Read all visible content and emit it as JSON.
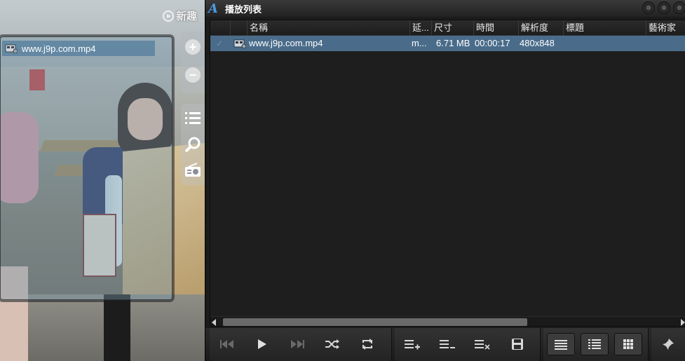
{
  "video": {
    "watermark": "新趣"
  },
  "mini_playlist": {
    "items": [
      {
        "name": "www.j9p.com.mp4"
      }
    ]
  },
  "video_controls": [
    {
      "icon": "zoom-in-icon"
    },
    {
      "icon": "zoom-out-icon"
    },
    {
      "icon": "playlist-icon"
    },
    {
      "icon": "search-icon"
    },
    {
      "icon": "radio-icon"
    }
  ],
  "window": {
    "title": "播放列表",
    "logo": "A"
  },
  "playlist": {
    "columns": [
      "名稱",
      "延...",
      "尺寸",
      "時間",
      "解析度",
      "標題",
      "藝術家"
    ],
    "rows": [
      {
        "name": "www.j9p.com.mp4",
        "ext": "m...",
        "size": "6.71 MB",
        "duration": "00:00:17",
        "resolution": "480x848",
        "title": "",
        "artist": ""
      }
    ]
  },
  "toolbar": {
    "buttons": [
      {
        "icon": "previous-icon",
        "enabled": false
      },
      {
        "icon": "play-icon",
        "enabled": true
      },
      {
        "icon": "next-icon",
        "enabled": false
      },
      {
        "icon": "shuffle-icon",
        "enabled": true
      },
      {
        "icon": "repeat-icon",
        "enabled": true
      },
      {
        "icon": "add-list-icon",
        "enabled": true
      },
      {
        "icon": "remove-list-icon",
        "enabled": true
      },
      {
        "icon": "clear-list-icon",
        "enabled": true
      },
      {
        "icon": "save-icon",
        "enabled": true
      },
      {
        "icon": "view-compact-icon",
        "enabled": true
      },
      {
        "icon": "view-list-icon",
        "enabled": true
      },
      {
        "icon": "view-grid-icon",
        "enabled": true
      },
      {
        "icon": "pin-icon",
        "enabled": true
      }
    ]
  },
  "colors": {
    "selected_row": "#4a6c8a",
    "window_bg": "#1b1b1b",
    "logo_blue": "#4a9be0"
  }
}
